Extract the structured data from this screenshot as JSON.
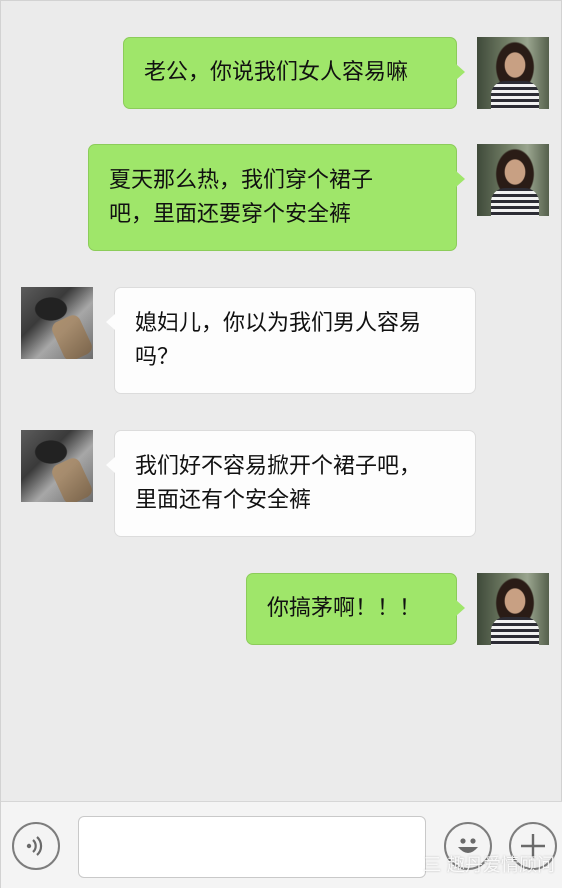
{
  "messages": [
    {
      "side": "sent",
      "text": "老公，你说我们女人容易嘛"
    },
    {
      "side": "sent",
      "text": "夏天那么热，我们穿个裙子\n吧，里面还要穿个安全裤"
    },
    {
      "side": "received",
      "text": "媳妇儿，你以为我们男人容易\n吗？"
    },
    {
      "side": "received",
      "text": "我们好不容易掀开个裙子吧，\n里面还有个安全裤"
    },
    {
      "side": "sent",
      "text": "你搞茅啊！！！"
    }
  ],
  "input": {
    "value": "",
    "placeholder": ""
  },
  "icons": {
    "voice": "voice-icon",
    "emoji": "emoji-icon",
    "add": "plus-icon"
  },
  "watermark": "三 趣丹爱情顾问",
  "colors": {
    "sent_bubble": "#9fe66a",
    "received_bubble": "#fdfdfd",
    "background": "#ebebeb"
  }
}
